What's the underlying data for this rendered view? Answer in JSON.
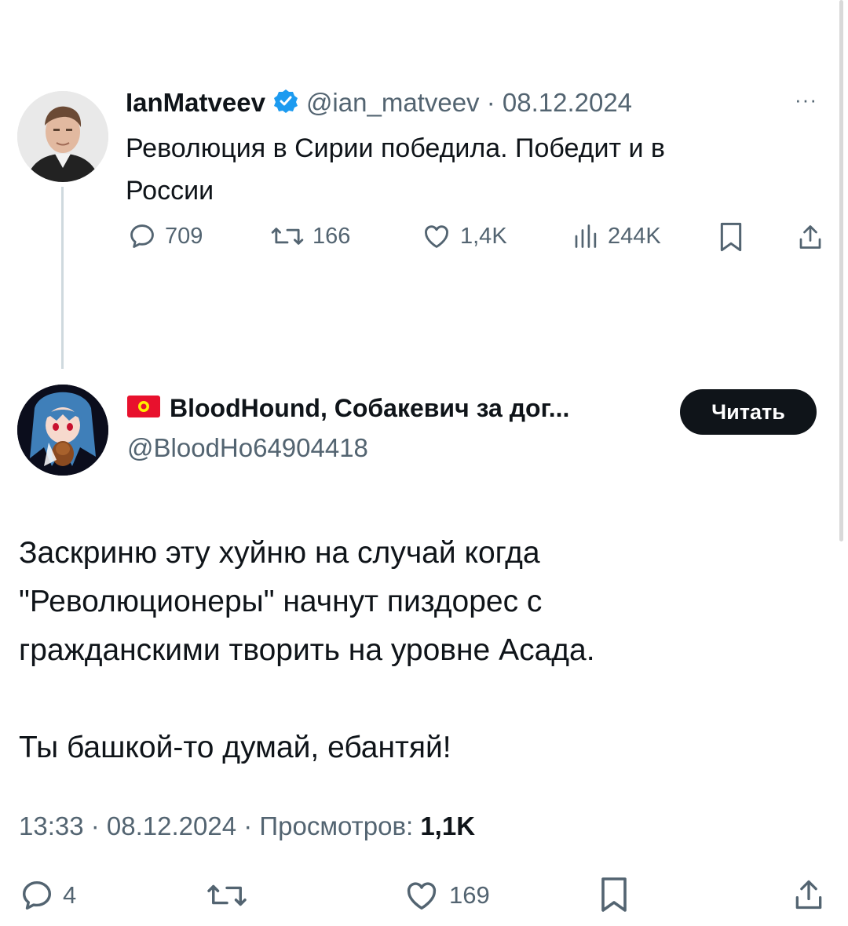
{
  "parent_tweet": {
    "display_name": "IanMatveev",
    "handle_and_date": "@ian_matveev · 08.12.2024",
    "more_label": "···",
    "text_line1": "Революция в Сирии победила. Победит и в",
    "text_line2": "России",
    "actions": {
      "replies": "709",
      "reposts": "166",
      "likes": "1,4K",
      "views": "244K"
    }
  },
  "reply_tweet": {
    "flag": "KG",
    "display_name": "BloodHound, Собакевич за дог...",
    "handle": "@BloodHo64904418",
    "follow_label": "Читать",
    "body_lines": [
      "Заскриню эту хуйню на случай когда",
      "\"Революционеры\" начнут пиздорес с",
      "гражданскими творить на уровне Асада.",
      "",
      "Ты башкой-то думай, ебантяй!"
    ],
    "meta_prefix": "13:33 · 08.12.2024 · Просмотров: ",
    "meta_views": "1,1K",
    "actions": {
      "replies": "4",
      "reposts": "",
      "likes": "169"
    }
  },
  "colors": {
    "text": "#0f1419",
    "muted": "#536471",
    "verified": "#1d9bf0",
    "flag_red": "#e8112d",
    "flag_yellow": "#ffef00"
  },
  "icons": [
    "comment-icon",
    "repost-icon",
    "like-icon",
    "views-icon",
    "bookmark-icon",
    "share-icon",
    "verified-badge-icon",
    "flag-kg-icon",
    "more-icon"
  ]
}
